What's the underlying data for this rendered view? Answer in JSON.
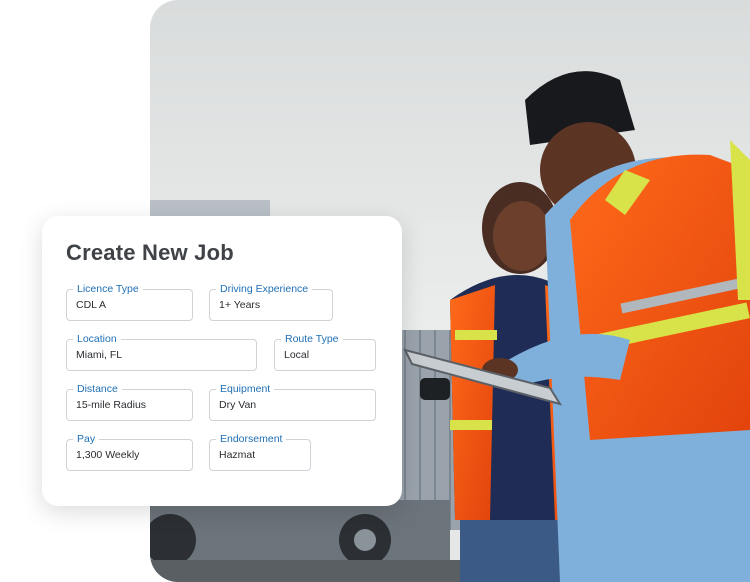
{
  "form": {
    "title": "Create New Job",
    "fields": [
      {
        "label": "Licence Type",
        "value": "CDL A"
      },
      {
        "label": "Driving Experience",
        "value": "1+ Years"
      },
      {
        "label": "Location",
        "value": "Miami, FL"
      },
      {
        "label": "Route Type",
        "value": "Local"
      },
      {
        "label": "Distance",
        "value": "15-mile Radius"
      },
      {
        "label": "Equipment",
        "value": "Dry Van"
      },
      {
        "label": "Pay",
        "value": "1,300 Weekly"
      },
      {
        "label": "Endorsement",
        "value": "Hazmat"
      }
    ]
  }
}
